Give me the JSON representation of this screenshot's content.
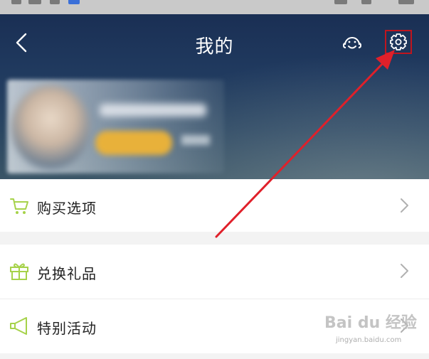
{
  "header": {
    "title": "我的",
    "back_icon": "chevron-left-icon",
    "service_icon": "smiley-service-icon",
    "settings_icon": "gear-icon"
  },
  "profile": {
    "avatar": "avatar-blurred",
    "name": "",
    "badge": ""
  },
  "menu": {
    "items": [
      {
        "label": "购买选项",
        "icon": "cart-icon"
      },
      {
        "label": "兑换礼品",
        "icon": "gift-icon"
      },
      {
        "label": "特别活动",
        "icon": "megaphone-icon"
      }
    ],
    "chevron_icon": "chevron-right-icon"
  },
  "annotation": {
    "arrow_color": "#e0202a",
    "highlight_color": "#c0151e"
  },
  "watermark": {
    "logo": "Bai du 经验",
    "url": "jingyan.baidu.com"
  },
  "colors": {
    "icon_accent": "#a6d24a",
    "header_dark": "#1a2f54"
  }
}
